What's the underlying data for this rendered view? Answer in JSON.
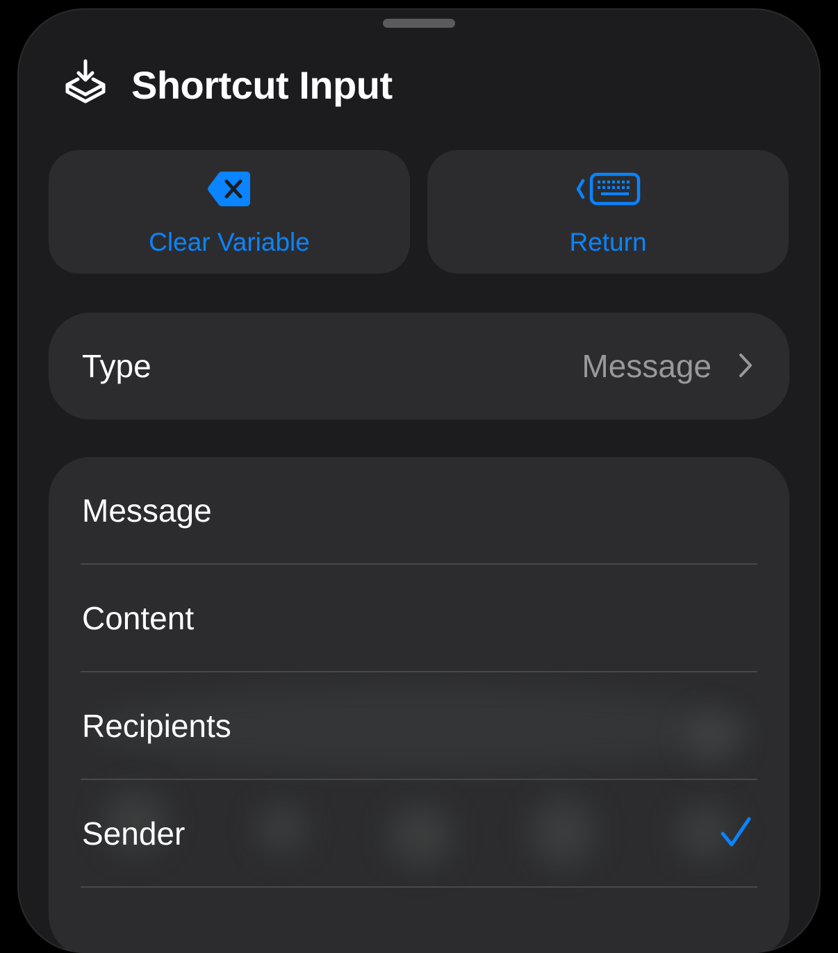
{
  "header": {
    "title": "Shortcut Input",
    "icon": "shortcut-input-icon"
  },
  "actions": {
    "clear_variable": {
      "label": "Clear Variable",
      "icon": "delete-left-icon"
    },
    "return": {
      "label": "Return",
      "icon": "keyboard-return-icon"
    }
  },
  "type_row": {
    "label": "Type",
    "value": "Message"
  },
  "list": {
    "items": [
      {
        "label": "Message",
        "checked": false
      },
      {
        "label": "Content",
        "checked": false
      },
      {
        "label": "Recipients",
        "checked": false
      },
      {
        "label": "Sender",
        "checked": true
      }
    ]
  },
  "colors": {
    "accent": "#0a84ff",
    "background": "#1c1c1e",
    "card": "#2c2c2e",
    "secondary_text": "#98989d"
  }
}
